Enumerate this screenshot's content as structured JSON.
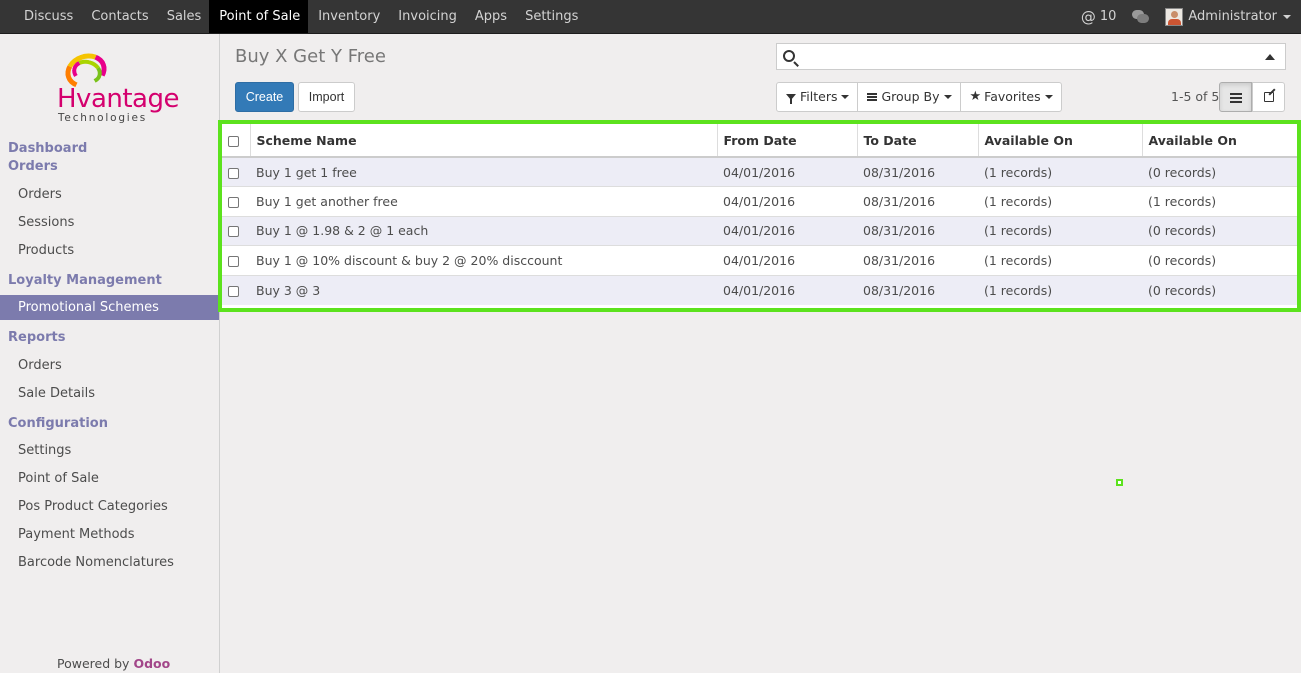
{
  "topbar": {
    "menu": [
      "Discuss",
      "Contacts",
      "Sales",
      "Point of Sale",
      "Inventory",
      "Invoicing",
      "Apps",
      "Settings"
    ],
    "active_menu": "Point of Sale",
    "mentions_count": "10",
    "user": "Administrator"
  },
  "sidebar": {
    "logo_text": "Hvantage",
    "logo_subtext": "Technologies",
    "sections": [
      {
        "label": "Dashboard"
      },
      {
        "label": "Orders",
        "items": [
          "Orders",
          "Sessions",
          "Products"
        ]
      },
      {
        "label": "Loyalty Management",
        "items": [
          "Promotional Schemes"
        ]
      },
      {
        "label": "Reports",
        "items": [
          "Orders",
          "Sale Details"
        ]
      },
      {
        "label": "Configuration",
        "items": [
          "Settings",
          "Point of Sale",
          "Pos Product Categories",
          "Payment Methods",
          "Barcode Nomenclatures"
        ]
      }
    ],
    "active_item": "Promotional Schemes",
    "powered_by": "Powered by",
    "powered_brand": "Odoo"
  },
  "control_panel": {
    "title": "Buy X Get Y Free",
    "create_label": "Create",
    "import_label": "Import",
    "search_value": "",
    "filters_label": "Filters",
    "group_by_label": "Group By",
    "favorites_label": "Favorites",
    "pager": "1-5 of 5"
  },
  "table": {
    "columns": [
      "Scheme Name",
      "From Date",
      "To Date",
      "Available On",
      "Available On"
    ],
    "rows": [
      [
        "Buy 1 get 1 free",
        "04/01/2016",
        "08/31/2016",
        "(1 records)",
        "(0 records)"
      ],
      [
        "Buy 1 get another free",
        "04/01/2016",
        "08/31/2016",
        "(1 records)",
        "(1 records)"
      ],
      [
        "Buy 1 @ 1.98 & 2 @ 1 each",
        "04/01/2016",
        "08/31/2016",
        "(1 records)",
        "(0 records)"
      ],
      [
        "Buy 1 @ 10% discount & buy 2 @ 20% disccount",
        "04/01/2016",
        "08/31/2016",
        "(1 records)",
        "(0 records)"
      ],
      [
        "Buy 3 @ 3",
        "04/01/2016",
        "08/31/2016",
        "(1 records)",
        "(0 records)"
      ]
    ]
  },
  "colors": {
    "accent": "#7c7bad",
    "primary": "#337ab7",
    "highlight": "#5ce21d",
    "navbar": "#353535"
  }
}
